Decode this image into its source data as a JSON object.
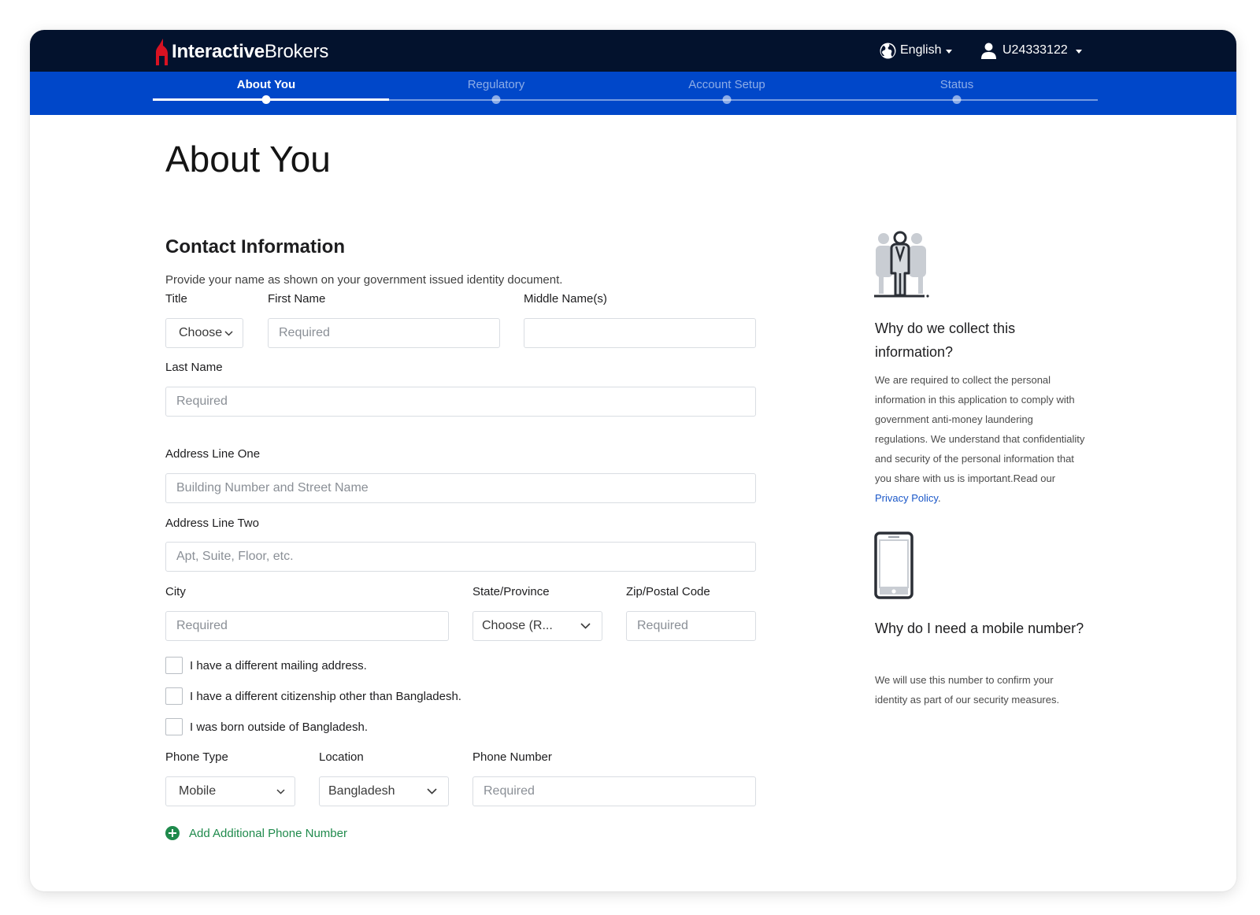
{
  "brand": {
    "name_bold": "Interactive",
    "name_regular": "Brokers"
  },
  "header": {
    "language": "English",
    "user_id": "U24333122"
  },
  "steps": [
    {
      "label": "About You",
      "active": true
    },
    {
      "label": "Regulatory",
      "active": false
    },
    {
      "label": "Account Setup",
      "active": false
    },
    {
      "label": "Status",
      "active": false
    }
  ],
  "page": {
    "title": "About You",
    "section_title": "Contact Information",
    "section_desc": "Provide your name as shown on your government issued identity document."
  },
  "form": {
    "title_label": "Title",
    "title_value": "Choose",
    "first_name_label": "First Name",
    "first_name_placeholder": "Required",
    "middle_name_label": "Middle Name(s)",
    "middle_name_placeholder": "",
    "last_name_label": "Last Name",
    "last_name_placeholder": "Required",
    "address1_label": "Address Line One",
    "address1_placeholder": "Building Number and Street Name",
    "address2_label": "Address Line Two",
    "address2_placeholder": "Apt, Suite, Floor, etc.",
    "city_label": "City",
    "city_placeholder": "Required",
    "state_label": "State/Province",
    "state_value": "Choose (R...",
    "zip_label": "Zip/Postal Code",
    "zip_placeholder": "Required",
    "checkboxes": [
      "I have a different mailing address.",
      "I have a different citizenship other than Bangladesh.",
      "I was born outside of Bangladesh."
    ],
    "phone_type_label": "Phone Type",
    "phone_type_value": "Mobile",
    "location_label": "Location",
    "location_value": "Bangladesh",
    "phone_number_label": "Phone Number",
    "phone_number_placeholder": "Required",
    "add_phone_label": "Add Additional Phone Number"
  },
  "sidebar": {
    "why_collect_title": "Why do we collect this information?",
    "why_collect_text": "We are required to collect the personal information in this application to comply with government anti-money laundering regulations. We understand that confidentiality and security of the personal information that you share with us is important.Read our ",
    "privacy_link": "Privacy Policy",
    "privacy_suffix": ".",
    "why_mobile_title": "Why do I need a mobile number?",
    "why_mobile_text": "We will use this number to confirm your identity as part of our security measures."
  },
  "colors": {
    "topbar": "#03122d",
    "stepper": "#0047c9",
    "logo_red": "#d81222",
    "link_blue": "#1a57c8",
    "add_green": "#1f8a4c"
  },
  "icons": [
    "logo-mark-icon",
    "globe-icon",
    "user-icon",
    "chevron-down-icon",
    "identity-people-icon",
    "mobile-phone-icon",
    "plus-circle-icon"
  ]
}
